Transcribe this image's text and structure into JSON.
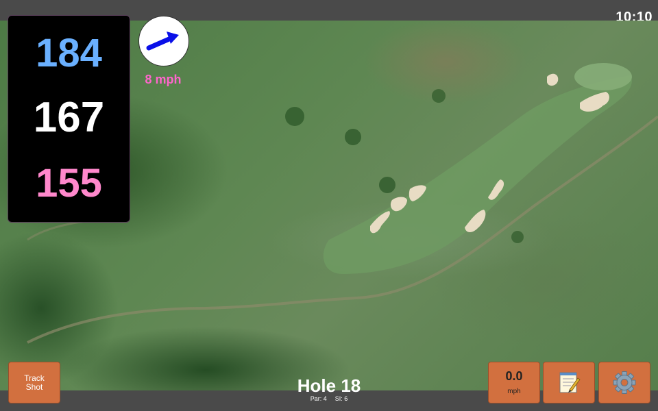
{
  "status_bar": {
    "time": "10:10"
  },
  "yardages": {
    "back": "184",
    "middle": "167",
    "front": "155"
  },
  "wind": {
    "speed_label": "8 mph",
    "icon": "arrow-east-northeast-icon",
    "arrow_color": "#0a10e8"
  },
  "hole": {
    "title": "Hole 18",
    "par": "Par: 4",
    "si": "SI: 6"
  },
  "buttons": {
    "track_shot": {
      "line1": "Track",
      "line2": "Shot"
    },
    "speed": {
      "value": "0.0",
      "unit": "mph"
    },
    "notes": {
      "icon": "notepad-icon"
    },
    "settings": {
      "icon": "gear-icon"
    }
  },
  "colors": {
    "button_bg": "#d2703f",
    "back_yardage": "#6ab0ff",
    "middle_yardage": "#ffffff",
    "front_yardage": "#ff88cc",
    "wind_text": "#ff66cc"
  }
}
